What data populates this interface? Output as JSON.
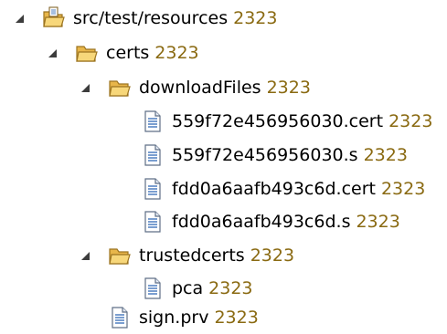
{
  "tree": {
    "root": {
      "label": "src/test/resources",
      "revision": "2323",
      "icon": "source-folder-icon",
      "expanded": true
    },
    "certs": {
      "label": "certs",
      "revision": "2323",
      "icon": "folder-icon",
      "expanded": true
    },
    "downloadFiles": {
      "label": "downloadFiles",
      "revision": "2323",
      "icon": "folder-icon",
      "expanded": true
    },
    "files_download": [
      {
        "label": "559f72e456956030.cert",
        "revision": "2323",
        "icon": "file-icon"
      },
      {
        "label": "559f72e456956030.s",
        "revision": "2323",
        "icon": "file-icon"
      },
      {
        "label": "fdd0a6aafb493c6d.cert",
        "revision": "2323",
        "icon": "file-icon"
      },
      {
        "label": "fdd0a6aafb493c6d.s",
        "revision": "2323",
        "icon": "file-icon"
      }
    ],
    "trustedcerts": {
      "label": "trustedcerts",
      "revision": "2323",
      "icon": "folder-icon",
      "expanded": true
    },
    "files_trusted": [
      {
        "label": "pca",
        "revision": "2323",
        "icon": "file-icon"
      }
    ],
    "sign": {
      "label": "sign.prv",
      "revision": "2323",
      "icon": "file-icon"
    }
  },
  "colors": {
    "revision": "#8a6a12",
    "folder_fill": "#f2c95e",
    "folder_stroke": "#b48a2a",
    "file_blue": "#4f7fc1"
  }
}
